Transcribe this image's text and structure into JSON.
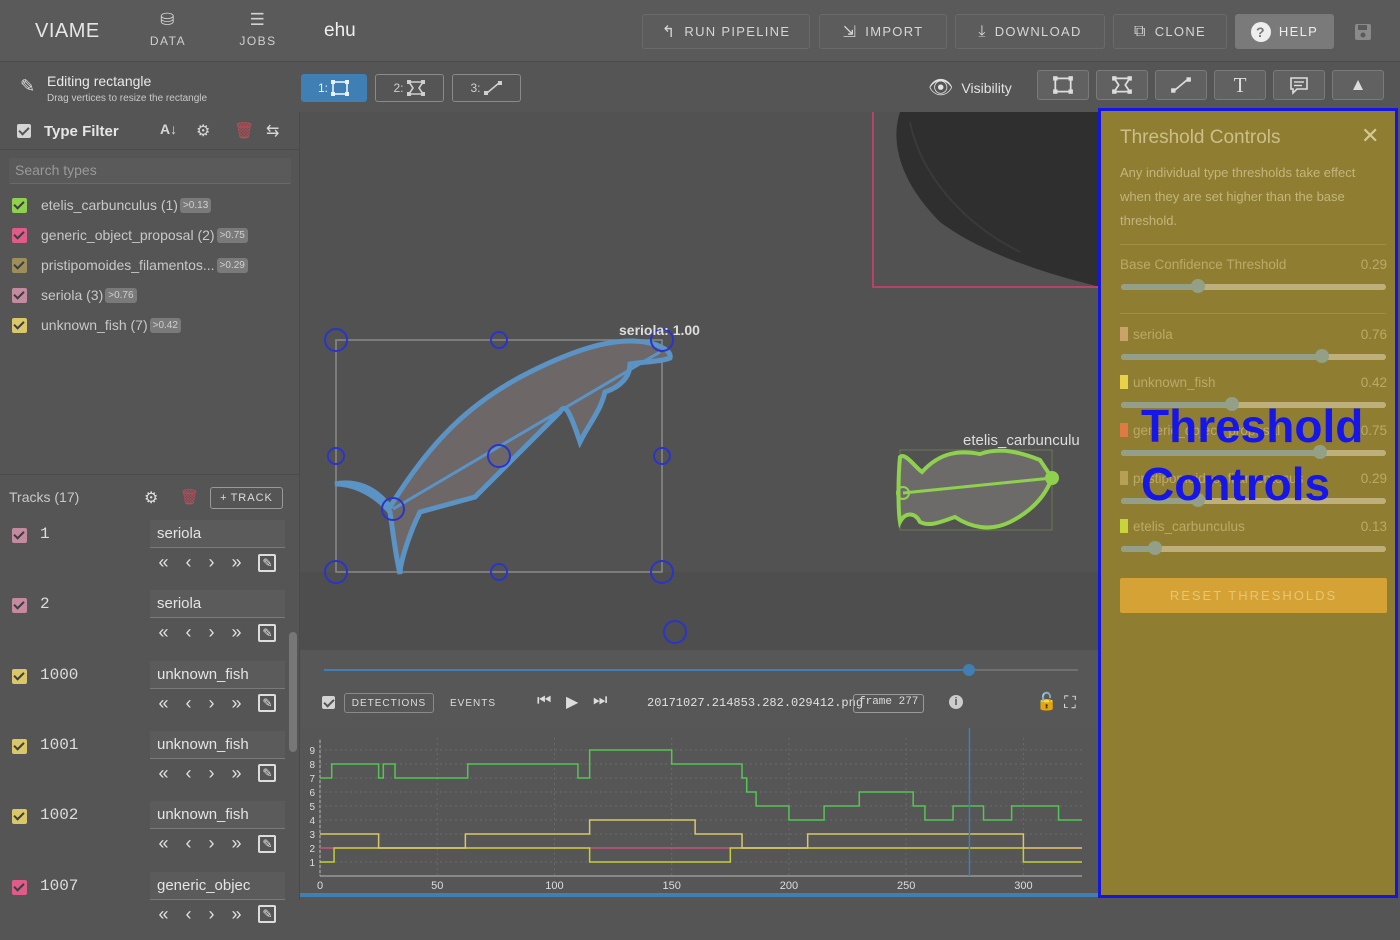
{
  "app": {
    "brand": "VIAME",
    "nav": [
      {
        "label": "DATA",
        "icon": "database-icon"
      },
      {
        "label": "JOBS",
        "icon": "list-check-icon"
      }
    ],
    "dataset_name": "ehu",
    "toolbar": {
      "run_pipeline": "RUN PIPELINE",
      "import": "IMPORT",
      "download": "DOWNLOAD",
      "clone": "CLONE",
      "help": "HELP"
    }
  },
  "edit_status": {
    "title": "Editing rectangle",
    "subtitle": "Drag vertices to resize the rectangle"
  },
  "modes": [
    {
      "label": "1:",
      "icon": "rectangle-icon",
      "active": true
    },
    {
      "label": "2:",
      "icon": "polygon-icon",
      "active": false
    },
    {
      "label": "3:",
      "icon": "line-icon",
      "active": false
    }
  ],
  "visibility": {
    "label": "Visibility",
    "tools": [
      "rectangle-icon",
      "polygon-icon",
      "line-icon",
      "text-icon",
      "comment-icon",
      "arrow-icon"
    ]
  },
  "type_filter": {
    "title": "Type Filter",
    "search_placeholder": "Search types",
    "types": [
      {
        "label": "etelis_carbunculus (1)",
        "badge": ">0.13",
        "color": "#8fd14f"
      },
      {
        "label": "generic_object_proposal (2)",
        "badge": ">0.75",
        "color": "#e05a8a"
      },
      {
        "label": "pristipomoides_filamentos...",
        "badge": ">0.29",
        "color": "#9e8f5a"
      },
      {
        "label": "seriola (3)",
        "badge": ">0.76",
        "color": "#c58aa0"
      },
      {
        "label": "unknown_fish (7)",
        "badge": ">0.42",
        "color": "#d9c76a"
      }
    ]
  },
  "tracks": {
    "title": "Tracks (17)",
    "add_label": "TRACK",
    "items": [
      {
        "id": "1",
        "type": "seriola",
        "color": "#c58aa0"
      },
      {
        "id": "2",
        "type": "seriola",
        "color": "#c58aa0"
      },
      {
        "id": "1000",
        "type": "unknown_fish",
        "color": "#d9c76a"
      },
      {
        "id": "1001",
        "type": "unknown_fish",
        "color": "#d9c76a"
      },
      {
        "id": "1002",
        "type": "unknown_fish",
        "color": "#d9c76a"
      },
      {
        "id": "1007",
        "type": "generic_objec",
        "color": "#e05a8a"
      }
    ]
  },
  "viewer": {
    "labels": [
      {
        "text": "seriola: 1.00",
        "color": "#5b93c4"
      },
      {
        "text": "etelis_carbunculu",
        "color": "#8fd14f"
      }
    ]
  },
  "player": {
    "detections": "DETECTIONS",
    "events": "EVENTS",
    "filename": "20171027.214853.282.029412.png",
    "frame": "frame 277",
    "progress": 0.856
  },
  "timeline": {
    "y_ticks": [
      "1",
      "2",
      "3",
      "4",
      "5",
      "6",
      "7",
      "8",
      "9"
    ],
    "x_ticks": [
      "0",
      "50",
      "100",
      "150",
      "200",
      "250",
      "300"
    ]
  },
  "threshold_panel": {
    "title": "Threshold Controls",
    "description": "Any individual type thresholds take effect when they are set higher than the base threshold.",
    "base_label": "Base Confidence Threshold",
    "base_value": 0.29,
    "items": [
      {
        "label": "seriola",
        "value": 0.76,
        "color": "#c9a36a"
      },
      {
        "label": "unknown_fish",
        "value": 0.42,
        "color": "#e8d24a"
      },
      {
        "label": "generic_object_proposal",
        "value": 0.75,
        "color": "#e07a45"
      },
      {
        "label": "pristipomoides_filamentosus",
        "value": 0.29,
        "color": "#b5a055"
      },
      {
        "label": "etelis_carbunculus",
        "value": 0.13,
        "color": "#c8d43a"
      }
    ],
    "reset_label": "RESET THRESHOLDS"
  },
  "overlay": {
    "line1": "Threshold",
    "line2": "Controls"
  }
}
